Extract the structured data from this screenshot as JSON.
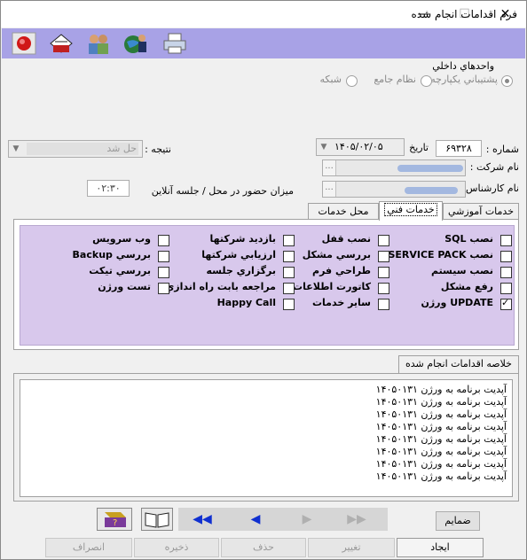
{
  "window": {
    "title": "فرم اقدامات انجام شده",
    "minimize": "—",
    "maximize": "☐",
    "close": "✕"
  },
  "toolbar": {
    "icons": [
      "printer-icon",
      "globe-user-icon",
      "users-icon",
      "form-stack-icon",
      "record-icon"
    ]
  },
  "units": {
    "label": "واحدهاي داخلي",
    "options": [
      {
        "label": "پشتيباني يکپارچه",
        "selected": true
      },
      {
        "label": "نظام جامع",
        "selected": false
      },
      {
        "label": "شبکه",
        "selected": false
      }
    ]
  },
  "form": {
    "number_label": "شماره :",
    "number_value": "۶۹۳۲۸",
    "date_label": "تاريخ",
    "date_value": "۱۴۰۵/۰۲/۰۵",
    "result_label": "نتيجه :",
    "result_value": "حل شد",
    "company_label": "نام شرکت :",
    "expert_label": "نام کارشناس :",
    "ellipsis": "...",
    "presence_label": "ميزان حضور در محل / جلسه آنلاين",
    "presence_value": "۰۲:۳۰"
  },
  "tabs": [
    {
      "label": "خدمات آموزشي",
      "active": false
    },
    {
      "label": "خدمات فني",
      "active": true
    },
    {
      "label": "محل خدمات",
      "active": false
    }
  ],
  "services": [
    {
      "label": "نصب SQL",
      "checked": false
    },
    {
      "label": "نصب قفل",
      "checked": false
    },
    {
      "label": "بازديد شرکتها",
      "checked": false
    },
    {
      "label": "وب سرويس",
      "checked": false
    },
    {
      "label": "نصب SERVICE PACK",
      "checked": false
    },
    {
      "label": "بررسي مشکل",
      "checked": false
    },
    {
      "label": "ارزيابي شرکتها",
      "checked": false
    },
    {
      "label": "بررسي Backup",
      "checked": false
    },
    {
      "label": "نصب سيستم",
      "checked": false
    },
    {
      "label": "طراحي فرم",
      "checked": false
    },
    {
      "label": "برگزاري جلسه",
      "checked": false
    },
    {
      "label": "بررسي تيکت",
      "checked": false
    },
    {
      "label": "رفع مشکل",
      "checked": false
    },
    {
      "label": "کاتورت اطلاعات",
      "checked": false
    },
    {
      "label": "مراجعه بابت راه اندازي",
      "checked": false
    },
    {
      "label": "تست ورژن",
      "checked": false
    },
    {
      "label": "UPDATE ورژن",
      "checked": true
    },
    {
      "label": "ساير خدمات",
      "checked": false
    },
    {
      "label": "Happy Call",
      "checked": false
    }
  ],
  "summary": {
    "title": "خلاصه اقدامات انجام شده",
    "lines": [
      "آپديت برنامه به ورژن ۱۴۰۵۰۱۳۱",
      "آپديت برنامه به ورژن ۱۴۰۵۰۱۳۱",
      "آپديت برنامه به ورژن ۱۴۰۵۰۱۳۱",
      "آپديت برنامه به ورژن ۱۴۰۵۰۱۳۱",
      "آپديت برنامه به ورژن ۱۴۰۵۰۱۳۱",
      "آپديت برنامه به ورژن ۱۴۰۵۰۱۳۱",
      "آپديت برنامه به ورژن ۱۴۰۵۰۱۳۱",
      "آپديت برنامه به ورژن ۱۴۰۵۰۱۳۱"
    ]
  },
  "nav": {
    "icons": [
      "first-record-icon",
      "previous-record-icon",
      "next-record-icon",
      "book-icon",
      "help-book-icon"
    ]
  },
  "attachments_label": "ضمايم",
  "actions": {
    "create": "ايجاد",
    "edit": "تغيير",
    "delete": "حذف",
    "save": "ذخيره",
    "cancel": "انصراف"
  }
}
